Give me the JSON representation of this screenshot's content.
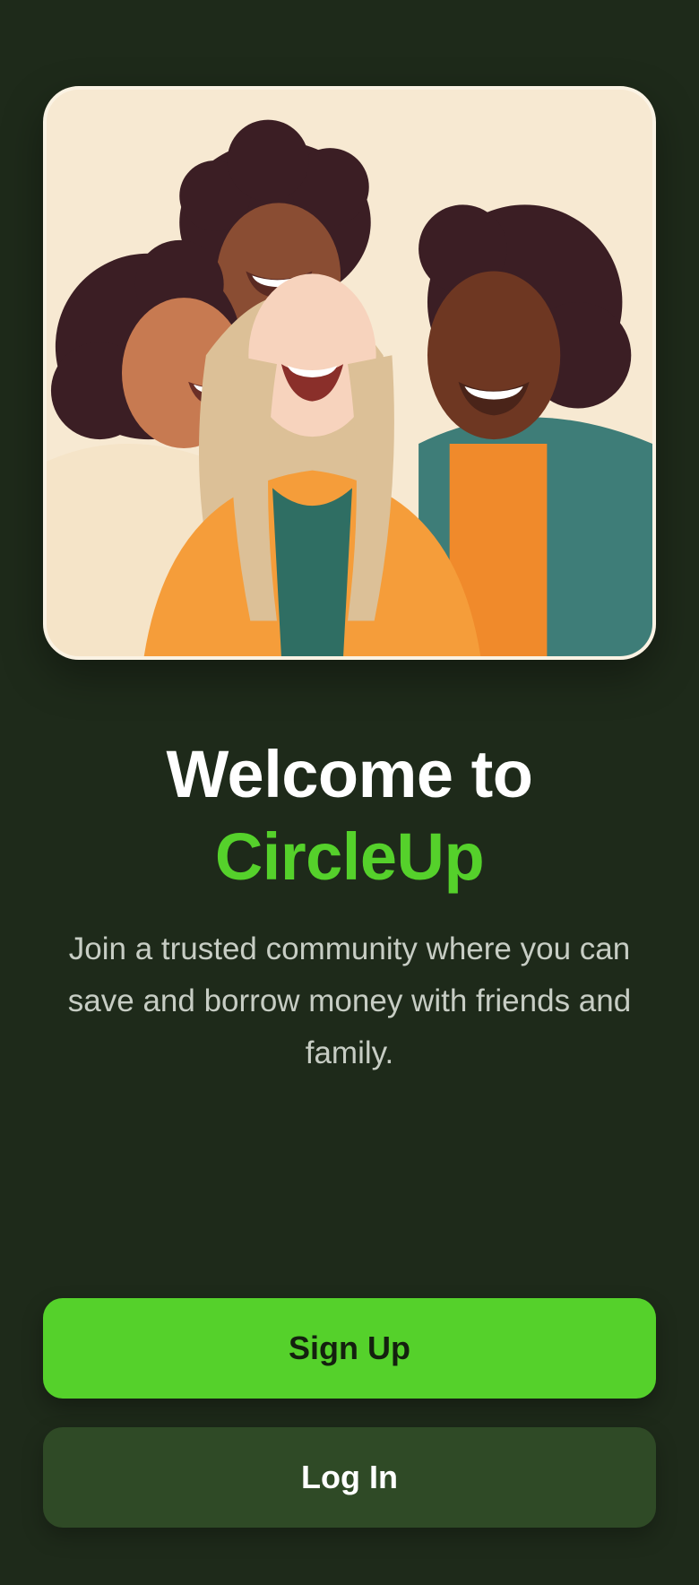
{
  "welcome": {
    "title_line1": "Welcome to",
    "brand_name": "CircleUp",
    "description": "Join a trusted community where you can save and borrow money with friends and family."
  },
  "actions": {
    "signup_label": "Sign Up",
    "login_label": "Log In"
  },
  "colors": {
    "background": "#1e2a1a",
    "accent": "#55d12b",
    "secondary_button": "#2f4a26",
    "hero_background": "#f7e9d2"
  }
}
